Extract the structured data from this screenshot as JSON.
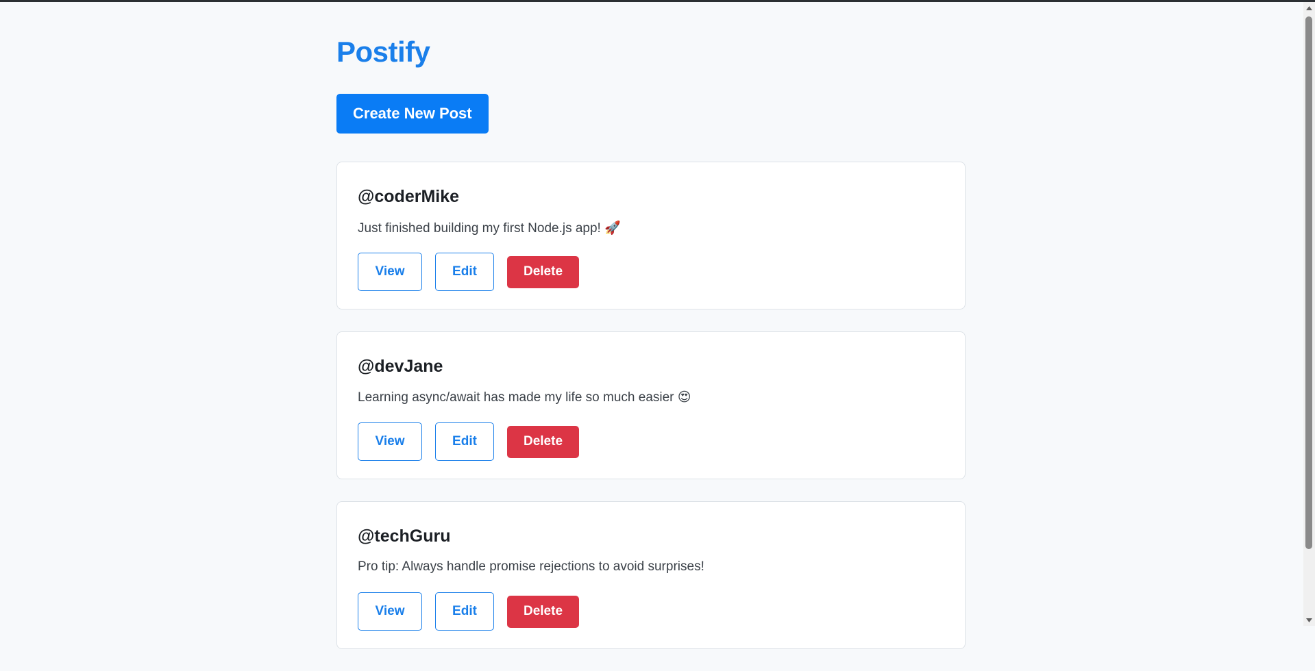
{
  "app": {
    "title": "Postify",
    "create_button_label": "Create New Post"
  },
  "posts": [
    {
      "author": "@coderMike",
      "content": "Just finished building my first Node.js app! 🚀",
      "view_label": "View",
      "edit_label": "Edit",
      "delete_label": "Delete"
    },
    {
      "author": "@devJane",
      "content": "Learning async/await has made my life so much easier 😍",
      "view_label": "View",
      "edit_label": "Edit",
      "delete_label": "Delete"
    },
    {
      "author": "@techGuru",
      "content": "Pro tip: Always handle promise rejections to avoid surprises!",
      "view_label": "View",
      "edit_label": "Edit",
      "delete_label": "Delete"
    }
  ],
  "colors": {
    "accent": "#1a7fea",
    "primary_button": "#0a7cf5",
    "danger": "#dc3545",
    "background": "#f7f9fb"
  },
  "icons": {
    "scroll_up": "scroll-up-arrow-icon",
    "scroll_down": "scroll-down-arrow-icon"
  }
}
